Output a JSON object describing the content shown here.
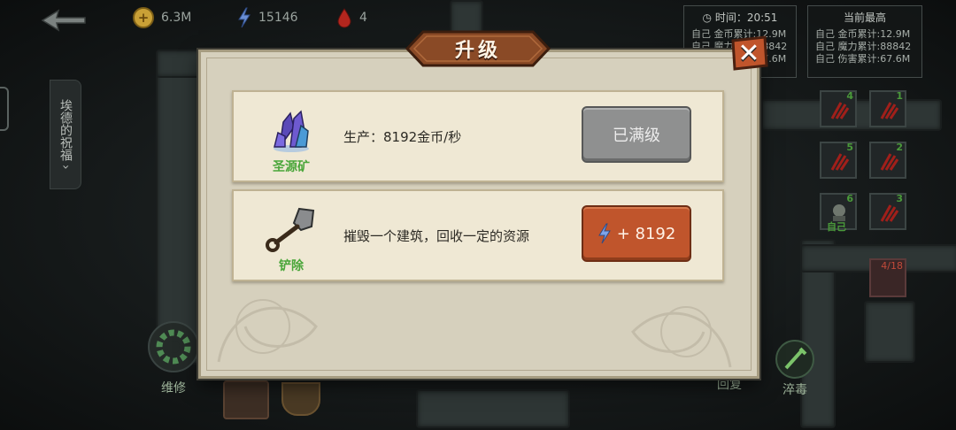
{
  "hud": {
    "gold": "6.3M",
    "mana": "15146",
    "blood": "4"
  },
  "info_left": {
    "time_label": "时间：",
    "time": "20:51",
    "lines": [
      "自己 金币累计:12.9M",
      "自己 魔力累计:88842",
      "自己 伤害累计:67.6M"
    ]
  },
  "info_right": {
    "title": "当前最高",
    "lines": [
      "自己 金币累计:12.9M",
      "自己 魔力累计:88842",
      "自己 伤害累计:67.6M"
    ]
  },
  "side_tab": {
    "label": "埃德的祝福"
  },
  "skills": [
    {
      "num": "4"
    },
    {
      "num": "1"
    },
    {
      "num": "5"
    },
    {
      "num": "2"
    },
    {
      "num": "6",
      "label": "自己"
    },
    {
      "num": "3"
    }
  ],
  "bottom": {
    "repair": "维修",
    "recover": "回复",
    "poison": "淬毒",
    "enemy_count": "4/18"
  },
  "modal": {
    "title": "升级",
    "close": "✕",
    "rows": [
      {
        "icon_label": "圣源矿",
        "description": "生产：8192金币/秒",
        "button": "已满级",
        "button_state": "disabled"
      },
      {
        "icon_label": "铲除",
        "description": "摧毁一个建筑，回收一定的资源",
        "button": "+ 8192",
        "button_state": "enabled"
      }
    ]
  },
  "colors": {
    "accent_orange": "#c0552c",
    "green_label": "#4aa63a",
    "panel_bg": "#d6d0bd"
  }
}
